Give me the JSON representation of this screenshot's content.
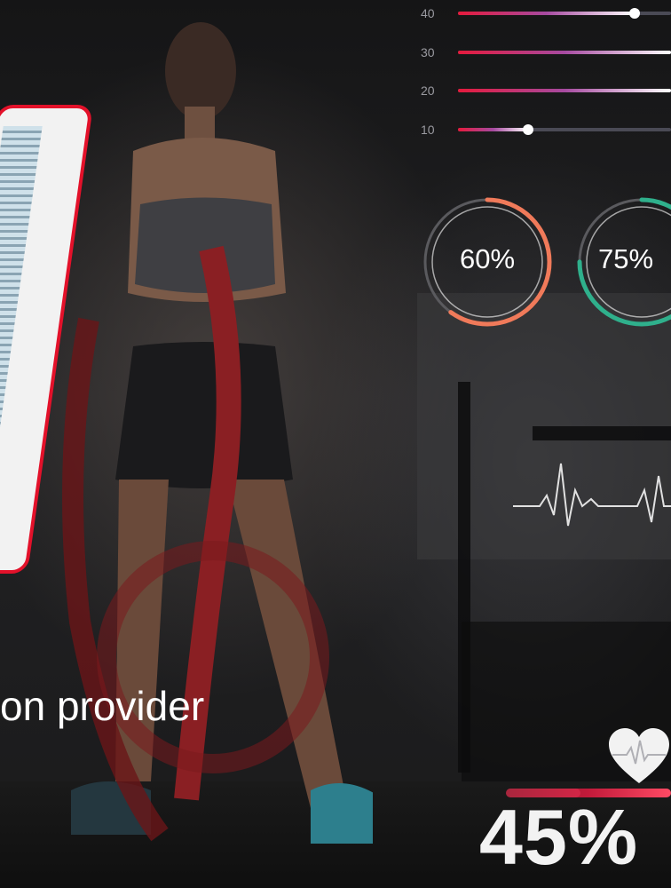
{
  "sliders": [
    {
      "label": "40",
      "value": 0.83
    },
    {
      "label": "30",
      "value": 1.0
    },
    {
      "label": "20",
      "value": 1.0
    },
    {
      "label": "10",
      "value": 0.33
    }
  ],
  "gauges": [
    {
      "label": "60%",
      "value": 0.6,
      "color": "#f07a5a"
    },
    {
      "label": "75%",
      "value": 0.75,
      "color": "#2fb08c"
    }
  ],
  "caption": {
    "text": "on provider"
  },
  "heart_rate": {
    "icon": "heart-pulse-icon",
    "value_text": "45%",
    "value": 0.45,
    "bar_color": "#c21a3a"
  },
  "colors": {
    "accent": "#e3112a",
    "track": "#4a4a55"
  }
}
